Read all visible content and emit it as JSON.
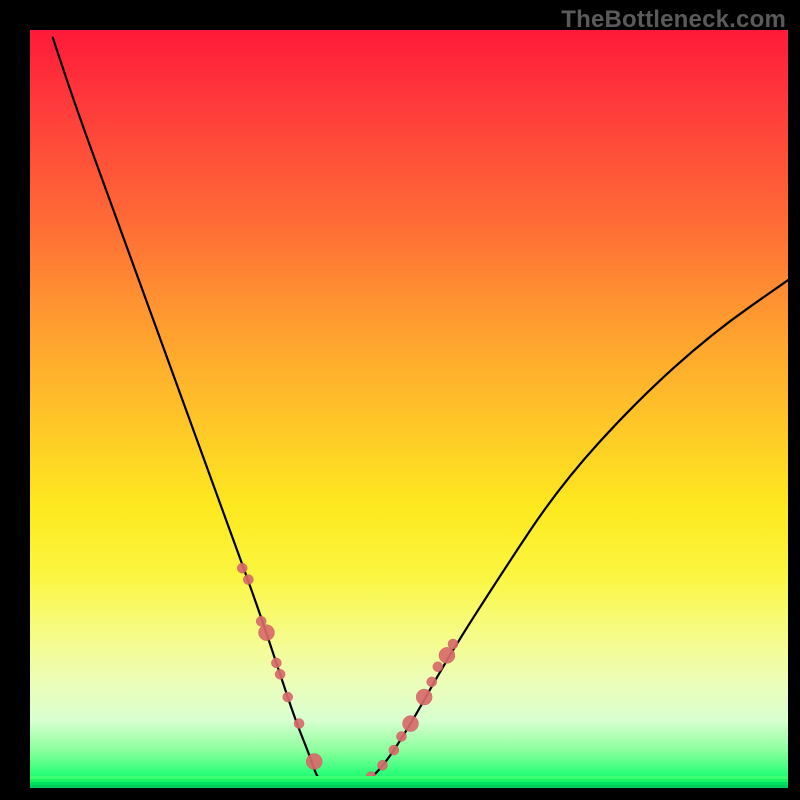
{
  "watermark": "TheBottleneck.com",
  "colors": {
    "curve": "#000000",
    "marker_fill": "#d86b6b",
    "marker_stroke": "#c85b5b",
    "background": "#000000"
  },
  "chart_data": {
    "type": "line",
    "title": "",
    "xlabel": "",
    "ylabel": "",
    "xlim": [
      0,
      100
    ],
    "ylim": [
      0,
      100
    ],
    "curve": {
      "x": [
        3,
        6,
        10,
        14,
        18,
        22,
        26,
        30,
        33,
        35,
        37,
        38,
        40,
        43,
        46,
        50,
        55,
        62,
        70,
        80,
        90,
        100
      ],
      "y": [
        99,
        90,
        79,
        68,
        57,
        46,
        35,
        24,
        15,
        9,
        4,
        1,
        0,
        0,
        2,
        8,
        17,
        28,
        40,
        51,
        60,
        67
      ]
    },
    "markers": {
      "x": [
        28.0,
        28.8,
        30.5,
        31.2,
        32.5,
        33.0,
        34.0,
        35.5,
        37.5,
        40.0,
        43.0,
        45.0,
        46.5,
        48.0,
        49.0,
        50.2,
        52.0,
        53.0,
        53.8,
        55.0,
        55.8
      ],
      "y": [
        29.0,
        27.5,
        22.0,
        20.5,
        16.5,
        15.0,
        12.0,
        8.5,
        3.5,
        0.5,
        0.5,
        1.5,
        3.0,
        5.0,
        6.8,
        8.5,
        12.0,
        14.0,
        16.0,
        17.5,
        19.0
      ],
      "r_small": 5,
      "r_large": 8
    }
  }
}
